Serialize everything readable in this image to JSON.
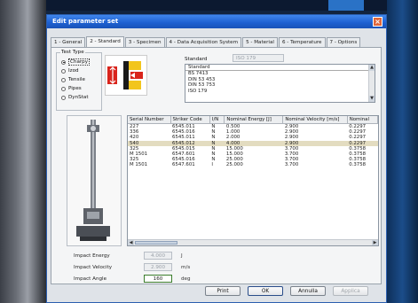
{
  "window": {
    "title": "Edit parameter set",
    "close_glyph": "×"
  },
  "tabs": [
    {
      "label": "1 - General"
    },
    {
      "label": "2 - Standard"
    },
    {
      "label": "3 - Specimen"
    },
    {
      "label": "4 - Data Acquisition System"
    },
    {
      "label": "5 - Material"
    },
    {
      "label": "6 - Temperature"
    },
    {
      "label": "7 - Options"
    }
  ],
  "active_tab": "2 - Standard",
  "test_type": {
    "legend": "Test Type",
    "options": [
      {
        "label": "Charpy",
        "checked": true
      },
      {
        "label": "Izod",
        "checked": false
      },
      {
        "label": "Tensile",
        "checked": false
      },
      {
        "label": "Pipes",
        "checked": false
      },
      {
        "label": "DynStat",
        "checked": false
      }
    ]
  },
  "standard": {
    "label": "Standard",
    "value": "ISO 179",
    "list_header": "Standard",
    "list_items": [
      "BS 7413",
      "DIN 53 453",
      "DIN 53 753",
      "ISO 179"
    ]
  },
  "strikers": {
    "columns": [
      "Serial Number",
      "Striker Code",
      "I/N",
      "Nominal Energy [J]",
      "Nominal Velocity [m/s]",
      "Nominal"
    ],
    "rows": [
      [
        "227",
        "6545.011",
        "N",
        "0.500",
        "2.900",
        "0.2297"
      ],
      [
        "336",
        "6545.016",
        "N",
        "1.000",
        "2.900",
        "0.2297"
      ],
      [
        "420",
        "6545.011",
        "N",
        "2.000",
        "2.900",
        "0.2297"
      ],
      [
        "540",
        "6545.012",
        "N",
        "4.000",
        "2.900",
        "0.2297"
      ],
      [
        "325",
        "6545.015",
        "N",
        "15.000",
        "3.700",
        "0.3758"
      ],
      [
        "M 1501",
        "6547.601",
        "N",
        "15.000",
        "3.700",
        "0.3758"
      ],
      [
        "325",
        "6545.016",
        "N",
        "25.000",
        "3.700",
        "0.3758"
      ],
      [
        "M 1501",
        "6547.601",
        "I",
        "25.000",
        "3.700",
        "0.3758"
      ]
    ],
    "selected_row": 3
  },
  "parameters": {
    "impact_energy": {
      "label": "Impact Energy",
      "value": "4.000",
      "unit": "J"
    },
    "impact_velocity": {
      "label": "Impact Velocity",
      "value": "2.900",
      "unit": "m/s"
    },
    "impact_angle": {
      "label": "Impact Angle",
      "value": "160",
      "unit": "deg"
    }
  },
  "buttons": {
    "print": "Print",
    "ok": "OK",
    "cancel": "Annulla",
    "apply": "Applica"
  },
  "colors": {
    "titlebar": "#1d5fd0",
    "selected_row": "#e3dcc0",
    "accent_red": "#d9241c",
    "accent_yellow": "#f2c51c"
  }
}
